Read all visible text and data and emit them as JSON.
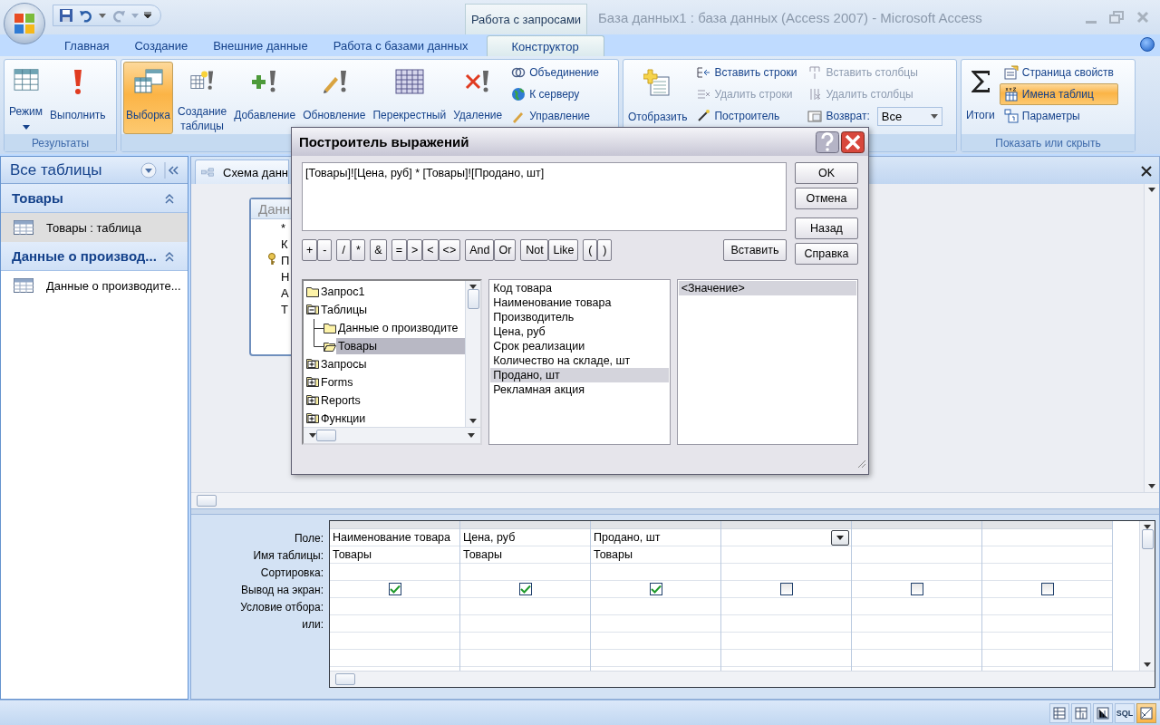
{
  "window": {
    "title": "База данных1 : база данных (Access 2007) - Microsoft Access",
    "contextual_tab": "Работа с запросами"
  },
  "ribbon_tabs": [
    {
      "label": "Главная",
      "selected": false
    },
    {
      "label": "Создание",
      "selected": false
    },
    {
      "label": "Внешние данные",
      "selected": false
    },
    {
      "label": "Работа с базами данных",
      "selected": false
    },
    {
      "label": "Конструктор",
      "selected": true
    }
  ],
  "ribbon_groups": [
    {
      "label": "Результаты",
      "large": [
        {
          "label": "Режим",
          "selected": false,
          "dropdown": true
        },
        {
          "label": "Выполнить",
          "selected": false,
          "dropdown": false
        }
      ]
    },
    {
      "large": [
        {
          "label": "Выборка",
          "selected": true,
          "dropdown": false
        },
        {
          "label": "Создание таблицы",
          "selected": false,
          "dropdown": false
        },
        {
          "label": "Добавление",
          "selected": false,
          "dropdown": false
        },
        {
          "label": "Обновление",
          "selected": false,
          "dropdown": false
        },
        {
          "label": "Перекрестный",
          "selected": false,
          "dropdown": false
        },
        {
          "label": "Удаление",
          "selected": false,
          "dropdown": false
        }
      ],
      "columns": [
        [
          {
            "kind": "button",
            "label": "Объединение",
            "disabled": false,
            "selected": false
          },
          {
            "kind": "button",
            "label": "К серверу",
            "disabled": false,
            "selected": false
          },
          {
            "kind": "button",
            "label": "Управление",
            "disabled": false,
            "selected": false
          }
        ]
      ]
    },
    {
      "large": [
        {
          "label": "Отобразить",
          "selected": false,
          "dropdown": false
        }
      ],
      "columns": [
        [
          {
            "kind": "button",
            "label": "Вставить строки",
            "disabled": false,
            "selected": false
          },
          {
            "kind": "button",
            "label": "Удалить строки",
            "disabled": true,
            "selected": false
          },
          {
            "kind": "button",
            "label": "Построитель",
            "disabled": false,
            "selected": false
          }
        ],
        [
          {
            "kind": "button",
            "label": "Вставить столбцы",
            "disabled": true,
            "selected": false
          },
          {
            "kind": "button",
            "label": "Удалить столбцы",
            "disabled": true,
            "selected": false
          },
          {
            "kind": "combo",
            "label": "Возврат:",
            "value": "Все",
            "disabled": false,
            "selected": false
          }
        ]
      ]
    },
    {
      "label": "Показать или скрыть",
      "large": [
        {
          "label": "Итоги",
          "selected": false,
          "dropdown": false
        }
      ],
      "columns": [
        [
          {
            "kind": "button",
            "label": "Страница свойств",
            "disabled": false,
            "selected": false
          },
          {
            "kind": "button",
            "label": "Имена таблиц",
            "disabled": false,
            "selected": true
          },
          {
            "kind": "button",
            "label": "Параметры",
            "disabled": false,
            "selected": false
          }
        ]
      ]
    }
  ],
  "nav_pane": {
    "title": "Все таблицы",
    "groups": [
      {
        "label": "Товары",
        "items": [
          {
            "label": "Товары : таблица",
            "selected": true
          }
        ]
      },
      {
        "label": "Данные о производ...",
        "items": [
          {
            "label": "Данные о производите...",
            "selected": false
          }
        ]
      }
    ]
  },
  "document": {
    "tab": "Схема данн",
    "table_box": {
      "title": "Данн",
      "fields": [
        {
          "label": "*",
          "primary_key": false
        },
        {
          "label": "К",
          "primary_key": false
        },
        {
          "label": "П",
          "primary_key": true
        },
        {
          "label": "Н",
          "primary_key": false
        },
        {
          "label": "А",
          "primary_key": false
        },
        {
          "label": "Т",
          "primary_key": false
        }
      ]
    }
  },
  "query_grid": {
    "row_labels": [
      "Поле:",
      "Имя таблицы:",
      "Сортировка:",
      "Вывод на экран:",
      "Условие отбора:",
      "или:"
    ],
    "columns": [
      {
        "field": "Наименование товара",
        "table": "Товары",
        "show": true,
        "active": false
      },
      {
        "field": "Цена, руб",
        "table": "Товары",
        "show": true,
        "active": false
      },
      {
        "field": "Продано, шт",
        "table": "Товары",
        "show": true,
        "active": false
      },
      {
        "show": false,
        "active": true
      },
      {
        "show": false,
        "active": false
      },
      {
        "show": false,
        "active": false
      }
    ]
  },
  "dialog": {
    "title": "Построитель выражений",
    "expression": "[Товары]![Цена, руб] * [Товары]![Продано, шт]",
    "side_buttons": [
      "OK",
      "Отмена",
      "Назад",
      "Справка"
    ],
    "insert_button": "Вставить",
    "operators": [
      [
        "+",
        "-"
      ],
      [
        "/",
        "*"
      ],
      [
        "&"
      ],
      [
        "=",
        ">",
        "<",
        "<>"
      ],
      [
        "And",
        "Or"
      ],
      [
        "Not",
        "Like"
      ],
      [
        "(",
        ")"
      ]
    ],
    "tree": [
      {
        "label": "Запрос1",
        "selected": false
      },
      {
        "label": "Таблицы",
        "selected": false,
        "expanded": true,
        "children": [
          {
            "label": "Данные о производите",
            "selected": false
          },
          {
            "label": "Товары",
            "selected": true
          }
        ]
      },
      {
        "label": "Запросы",
        "selected": false,
        "expanded": false
      },
      {
        "label": "Forms",
        "selected": false,
        "expanded": false
      },
      {
        "label": "Reports",
        "selected": false,
        "expanded": false
      },
      {
        "label": "Функции",
        "selected": false,
        "expanded": false
      }
    ],
    "fields": [
      {
        "label": "Код товара",
        "selected": false
      },
      {
        "label": "Наименование товара",
        "selected": false
      },
      {
        "label": "Производитель",
        "selected": false
      },
      {
        "label": "Цена, руб",
        "selected": false
      },
      {
        "label": "Срок реализации",
        "selected": false
      },
      {
        "label": "Количество на складе, шт",
        "selected": false
      },
      {
        "label": "Продано, шт",
        "selected": true
      },
      {
        "label": "Рекламная акция",
        "selected": false
      }
    ],
    "values": [
      {
        "label": "<Значение>",
        "selected": true
      }
    ]
  },
  "status_bar": {
    "views": [
      {
        "kind": "icon",
        "selected": false
      },
      {
        "kind": "icon",
        "selected": false
      },
      {
        "kind": "icon",
        "selected": false
      },
      {
        "kind": "text",
        "label": "SQL",
        "selected": false
      },
      {
        "kind": "icon",
        "selected": true
      }
    ]
  }
}
